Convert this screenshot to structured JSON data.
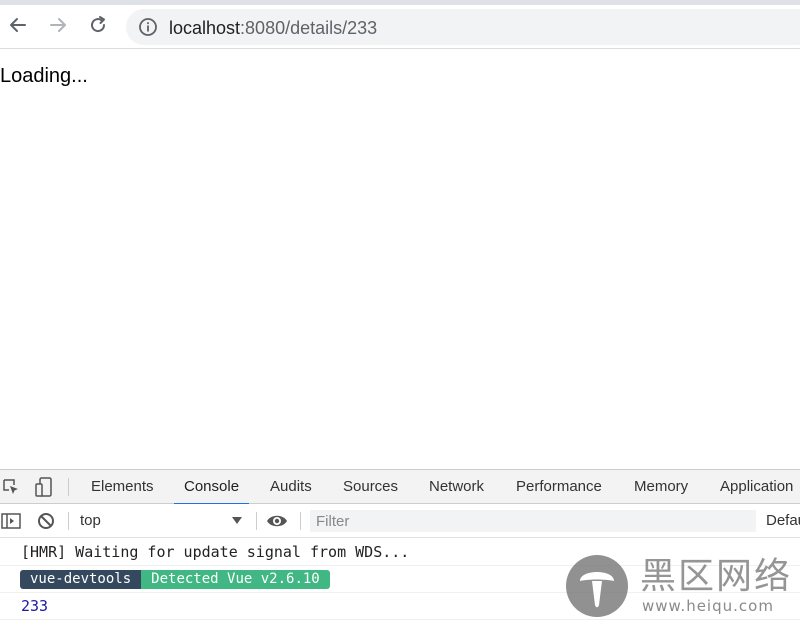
{
  "browser": {
    "url_host": "localhost",
    "url_path": ":8080/details/233",
    "icons": {
      "back": "arrow-left-icon",
      "forward": "arrow-right-icon",
      "reload": "reload-icon",
      "info": "info-icon"
    }
  },
  "page": {
    "text": "Loading..."
  },
  "devtools": {
    "tabs": [
      "Elements",
      "Console",
      "Audits",
      "Sources",
      "Network",
      "Performance",
      "Memory",
      "Application"
    ],
    "active_tab": "Console",
    "accent_color": "#1a73e8",
    "console_bar": {
      "context": "top",
      "filter_placeholder": "Filter",
      "levels_label": "Defau"
    },
    "messages": [
      {
        "text": "[HMR] Waiting for update signal from WDS..."
      },
      {
        "badge_left": "vue-devtools",
        "badge_right": "Detected Vue v2.6.10",
        "badge_left_color": "#35495e",
        "badge_right_color": "#41b883"
      },
      {
        "number": "233"
      }
    ]
  },
  "watermark": {
    "chinese": "黑区网络",
    "url": "www.heiqu.com"
  }
}
